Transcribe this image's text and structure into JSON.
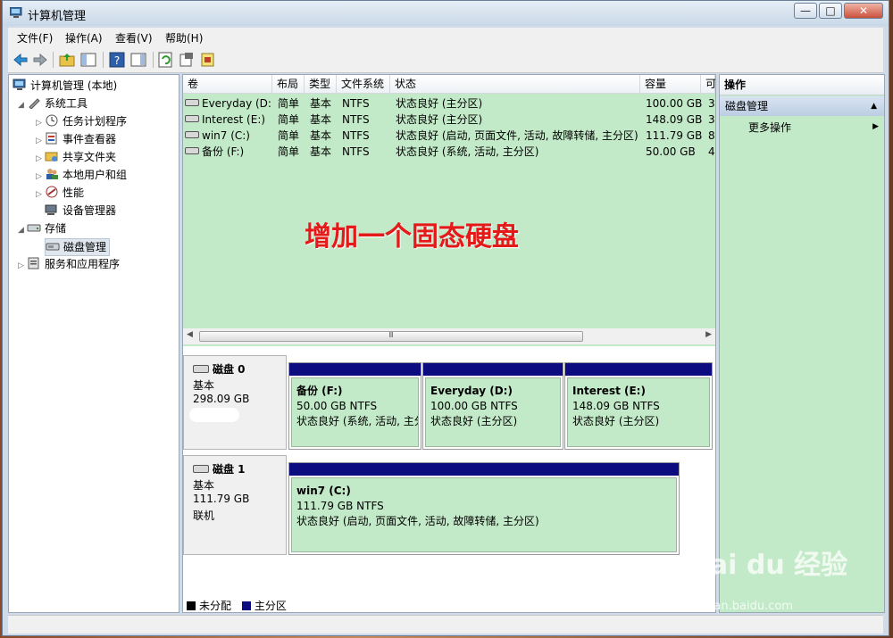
{
  "window": {
    "title": "计算机管理",
    "controls": [
      "—",
      "□",
      "✕"
    ]
  },
  "menu": [
    "文件(F)",
    "操作(A)",
    "查看(V)",
    "帮助(H)"
  ],
  "tree": {
    "root": "计算机管理 (本地)",
    "system_tools": "系统工具",
    "task_scheduler": "任务计划程序",
    "event_viewer": "事件查看器",
    "shared_folders": "共享文件夹",
    "local_users": "本地用户和组",
    "performance": "性能",
    "device_manager": "设备管理器",
    "storage": "存储",
    "disk_management": "磁盘管理",
    "services_apps": "服务和应用程序"
  },
  "volumes": {
    "headers": [
      "卷",
      "布局",
      "类型",
      "文件系统",
      "状态",
      "容量",
      "可"
    ],
    "rows": [
      [
        "Everyday (D:)",
        "简单",
        "基本",
        "NTFS",
        "状态良好 (主分区)",
        "100.00 GB",
        "3"
      ],
      [
        "Interest (E:)",
        "简单",
        "基本",
        "NTFS",
        "状态良好 (主分区)",
        "148.09 GB",
        "3"
      ],
      [
        "win7 (C:)",
        "简单",
        "基本",
        "NTFS",
        "状态良好 (启动, 页面文件, 活动, 故障转储, 主分区)",
        "111.79 GB",
        "8"
      ],
      [
        "备份 (F:)",
        "简单",
        "基本",
        "NTFS",
        "状态良好 (系统, 活动, 主分区)",
        "50.00 GB",
        "4"
      ]
    ],
    "scroll_grip": "Ⅲ"
  },
  "overlay_text": "增加一个固态硬盘",
  "disks": [
    {
      "name": "磁盘 0",
      "type": "基本",
      "size": "298.09 GB",
      "partitions": [
        {
          "name": "备份  (F:)",
          "size": "50.00 GB NTFS",
          "status": "状态良好 (系统, 活动, 主分区)"
        },
        {
          "name": "Everyday  (D:)",
          "size": "100.00 GB NTFS",
          "status": "状态良好 (主分区)"
        },
        {
          "name": "Interest  (E:)",
          "size": "148.09 GB NTFS",
          "status": "状态良好 (主分区)"
        }
      ]
    },
    {
      "name": "磁盘 1",
      "type": "基本",
      "size": "111.79 GB",
      "status": "联机",
      "partitions": [
        {
          "name": "win7  (C:)",
          "size": "111.79 GB NTFS",
          "status": "状态良好 (启动, 页面文件, 活动, 故障转储, 主分区)"
        }
      ]
    }
  ],
  "legend": {
    "unallocated": "未分配",
    "primary": "主分区"
  },
  "actions": {
    "header": "操作",
    "section": "磁盘管理",
    "more": "更多操作"
  },
  "watermark": {
    "brand": "Bai du 经验",
    "url": "jingyan.baidu.com"
  }
}
